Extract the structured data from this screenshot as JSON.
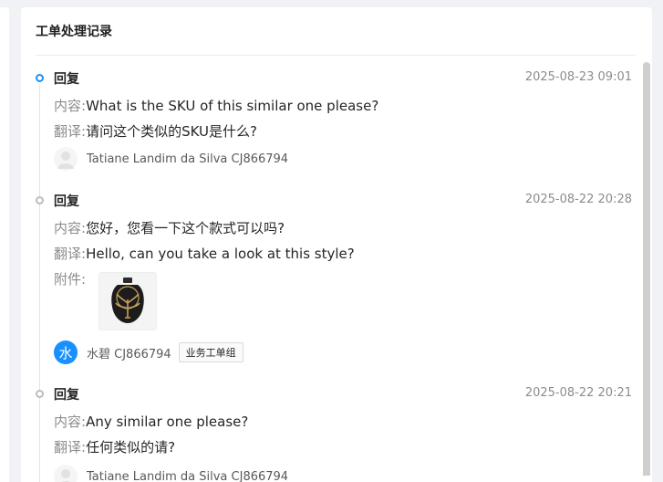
{
  "panel": {
    "title": "工单处理记录"
  },
  "labels": {
    "content": "内容:",
    "translation": "翻译:",
    "attachment": "附件:"
  },
  "entries": [
    {
      "type": "回复",
      "time": "2025-08-23 09:01",
      "content": "What is the SKU of this similar one please?",
      "translation": "请问这个类似的SKU是什么?",
      "author": "Tatiane Landim da Silva CJ866794",
      "active": true
    },
    {
      "type": "回复",
      "time": "2025-08-22 20:28",
      "content": "您好，您看一下这个款式可以吗?",
      "translation": "Hello, can you take a look at this style?",
      "attachment_icon": "product-photo-thumbnail",
      "author": "水碧 CJ866794",
      "avatar_initial": "水",
      "group": "业务工单组"
    },
    {
      "type": "回复",
      "time": "2025-08-22 20:21",
      "content": "Any similar one please?",
      "translation": "任何类似的请?",
      "author": "Tatiane Landim da Silva CJ866794"
    }
  ],
  "colors": {
    "accent": "#1890ff",
    "muted": "#8c8c8c",
    "text": "#262626"
  }
}
